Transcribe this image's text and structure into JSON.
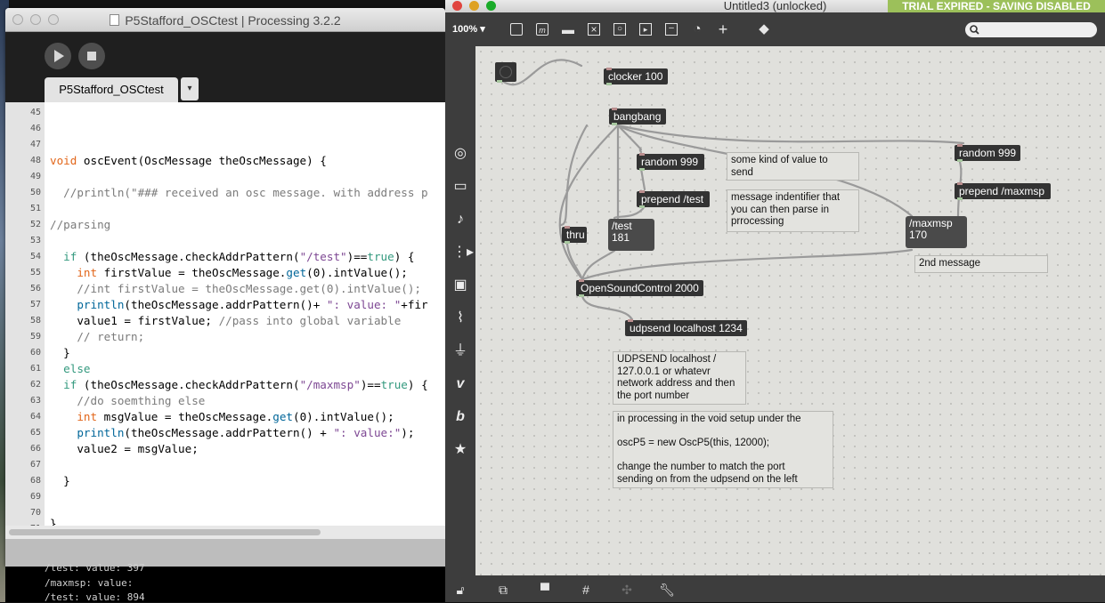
{
  "processing": {
    "title": "P5Stafford_OSCtest | Processing 3.2.2",
    "tab_label": "P5Stafford_OSCtest",
    "tab_menu": "▾",
    "play_icon": "play-icon",
    "stop_icon": "stop-icon",
    "line_numbers": [
      "45",
      "46",
      "47",
      "48",
      "49",
      "50",
      "51",
      "52",
      "53",
      "54",
      "55",
      "56",
      "57",
      "58",
      "59",
      "60",
      "61",
      "62",
      "63",
      "64",
      "65",
      "66",
      "67",
      "68",
      "69",
      "70",
      "71"
    ],
    "console": [
      "/test: value: 397",
      "/maxmsp: value:",
      "/test: value: 894"
    ]
  },
  "max": {
    "title": "Untitled3 (unlocked)",
    "trial_banner": "TRIAL EXPIRED - SAVING DISABLED",
    "zoom": "100%",
    "objects": {
      "clocker": "clocker 100",
      "bangbang": "bangbang",
      "random_left": "random 999",
      "prepend_test": "prepend /test",
      "thru": "thru",
      "random_right": "random 999",
      "prepend_maxmsp": "prepend /maxmsp",
      "osc": "OpenSoundControl 2000",
      "udpsend": "udpsend localhost 1234"
    },
    "messages": {
      "test_line1": "/test",
      "test_line2": "181",
      "maxmsp_line1": "/maxmsp",
      "maxmsp_line2": "170"
    },
    "comments": {
      "value_comment": "some kind of value to\nsend",
      "identifier_comment": "message indentifier that\nyou can then parse in\nprrocessing",
      "second_message": "2nd message",
      "udpsend_comment": "UDPSEND localhost /\n127.0.0.1 or whatevr\nnetwork address and then\nthe port number",
      "setup_comment": "in processing in the void setup under the\n\noscP5 = new OscP5(this, 12000);\n\nchange the number to match the port\nsending on from the udpsend on the left"
    }
  }
}
